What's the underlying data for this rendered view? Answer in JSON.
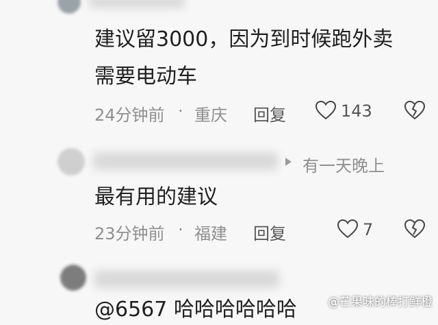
{
  "comments": [
    {
      "body_line1": "建议留3000，因为到时候跑外卖",
      "body_line2": "需要电动车",
      "time": "24分钟前",
      "location": "重庆",
      "reply_label": "回复",
      "like_count": "143"
    },
    {
      "reply_to": "有一天晚上",
      "body": "最有用的建议",
      "time": "23分钟前",
      "location": "福建",
      "reply_label": "回复",
      "like_count": "7"
    },
    {
      "body_partial": "@6567 哈哈哈哈哈哈"
    }
  ],
  "dot": "·",
  "watermark": "@芒果味的棒打鲜橙"
}
